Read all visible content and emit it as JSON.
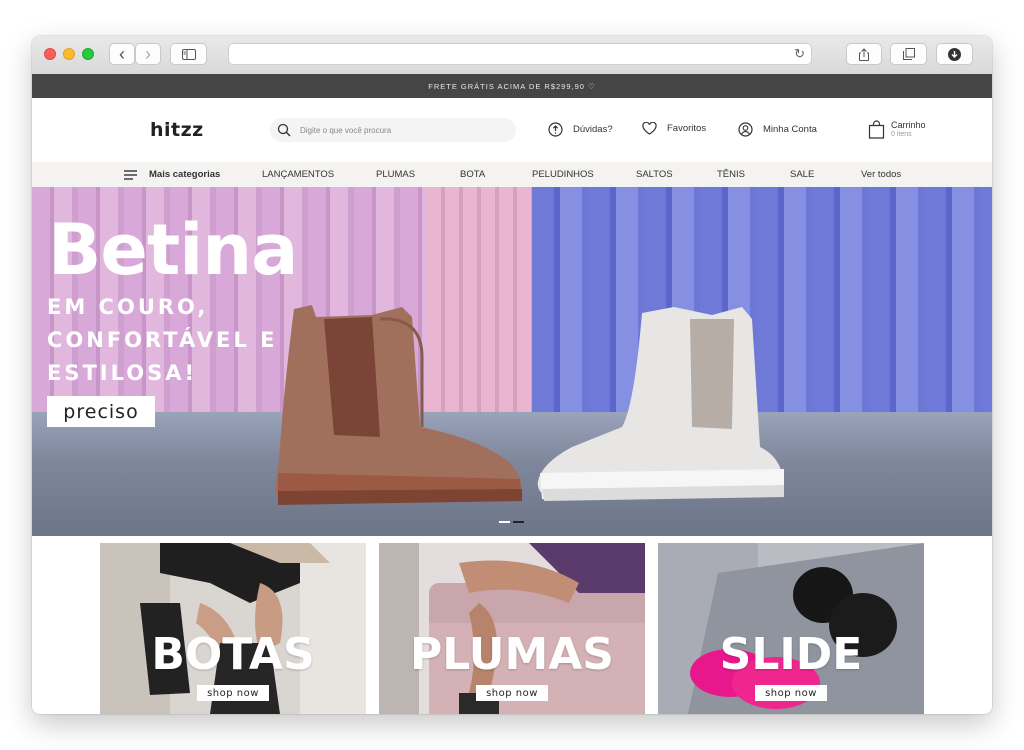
{
  "browser": {
    "back_glyph": "‹",
    "forward_glyph": "›",
    "address_value": "",
    "reload_glyph": "↻"
  },
  "promo": {
    "text": "FRETE GRÁTIS ACIMA DE R$299,90 ♡"
  },
  "header": {
    "logo": "hitzz",
    "search_placeholder": "Digite o que você procura",
    "help_label": "Dúvidas?",
    "favorites_label": "Favoritos",
    "account_label": "Minha Conta",
    "cart_label": "Carrinho",
    "cart_count": "0 itens"
  },
  "nav": {
    "menu_label": "Mais categorias",
    "items": [
      "LANÇAMENTOS",
      "PLUMAS",
      "BOTA",
      "PELUDINHOS",
      "SALTOS",
      "TÊNIS",
      "SALE",
      "Ver todos"
    ]
  },
  "hero": {
    "title": "Betina",
    "subtitle_lines": [
      "EM COURO,",
      "CONFORTÁVEL E",
      "ESTILOSA!"
    ],
    "button_label": "preciso",
    "slides": 2,
    "active_slide": 2
  },
  "categories": [
    {
      "label": "BOTAS",
      "button": "shop now"
    },
    {
      "label": "PLUMAS",
      "button": "shop now"
    },
    {
      "label": "SLIDE",
      "button": "shop now"
    }
  ],
  "colors": {
    "promo_bg": "#454545",
    "nav_bg": "#f4f3f1",
    "wall_pink": "#d8a9d8",
    "wall_blue": "#6f7ad8",
    "slide_pink": "#e8188c"
  }
}
